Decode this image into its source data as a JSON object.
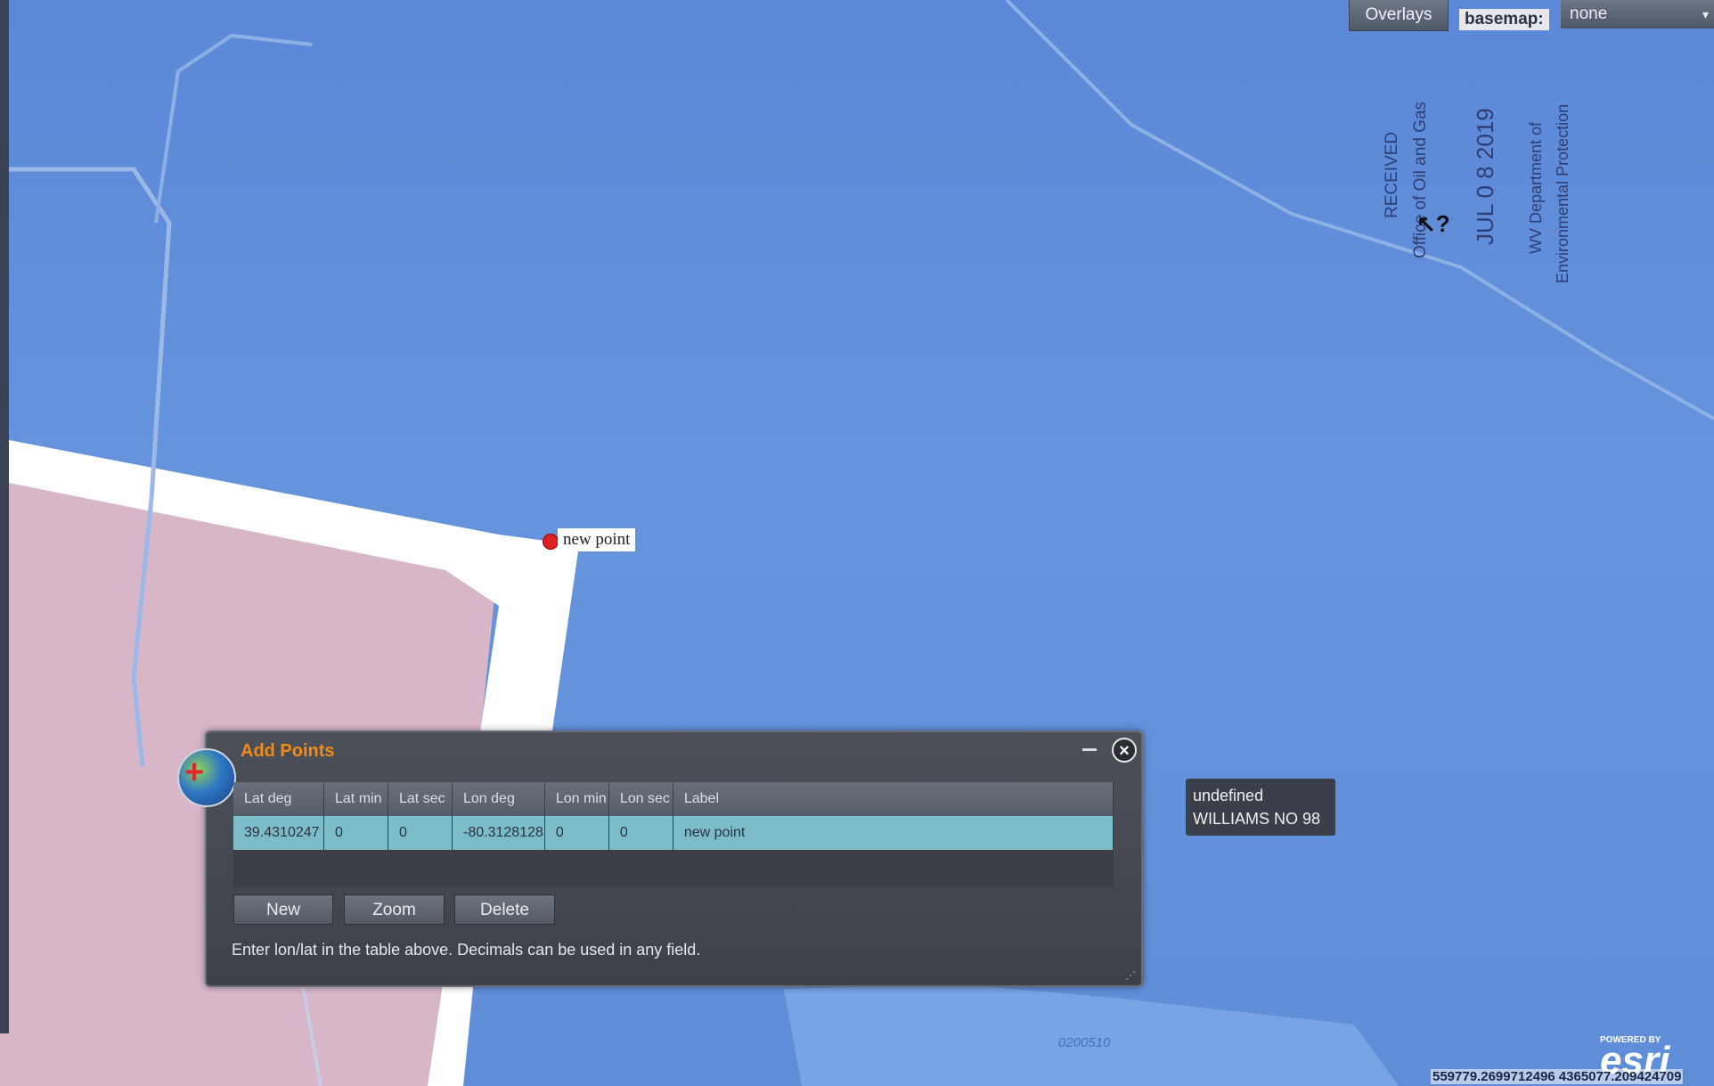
{
  "toolbar": {
    "overlays_label": "Overlays",
    "basemap_label": "basemap:",
    "basemap_value": "none"
  },
  "stamp": {
    "received": "RECEIVED",
    "office": "Office of Oil and Gas",
    "date": "JUL 0 8 2019",
    "dept_line1": "WV Department of",
    "dept_line2": "Environmental Protection"
  },
  "map": {
    "point_label": "new point",
    "road_label": "0200510"
  },
  "tooltip": {
    "line1": "undefined",
    "line2": "WILLIAMS NO 98"
  },
  "dialog": {
    "title": "Add Points",
    "columns": [
      "Lat deg",
      "Lat min",
      "Lat sec",
      "Lon deg",
      "Lon min",
      "Lon sec",
      "Label"
    ],
    "rows": [
      [
        "39.4310247",
        "0",
        "0",
        "-80.3128128",
        "0",
        "0",
        "new point"
      ]
    ],
    "buttons": {
      "new": "New",
      "zoom": "Zoom",
      "delete": "Delete"
    },
    "instructions": "Enter lon/lat in the table above. Decimals can be used in any field."
  },
  "footer": {
    "powered_by": "POWERED BY",
    "esri": "esri",
    "coordinates": "559779.2699712496 4365077.209424709"
  },
  "colors": {
    "water": "#6694dc",
    "land": "#d9b9c9",
    "accent_title": "#f08a18",
    "row_selected": "#7cbcc8",
    "marker": "#e02020"
  }
}
